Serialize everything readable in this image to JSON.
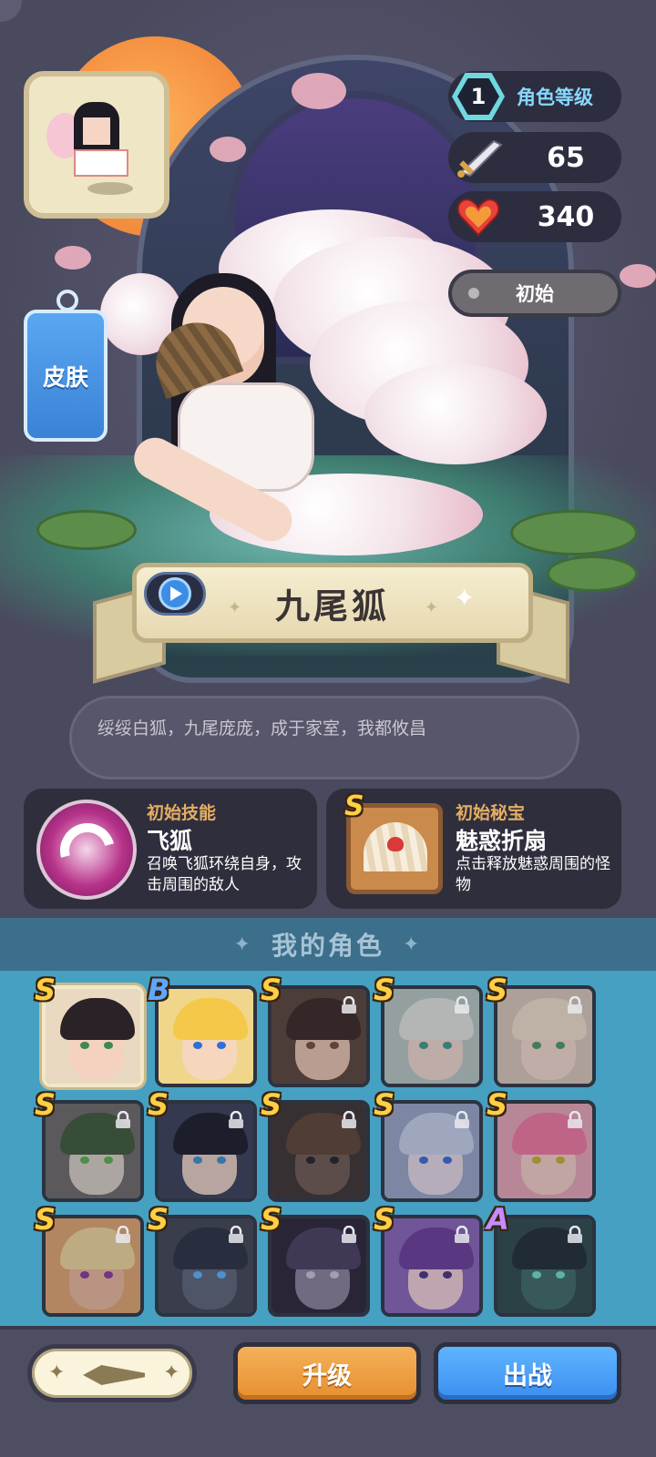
{
  "hero": {
    "name": "九尾狐",
    "quote": "绥绥白狐，九尾庞庞，成于家室，我都攸昌"
  },
  "stats": {
    "level": "1",
    "level_label": "角色等级",
    "attack": "65",
    "hp": "340",
    "status": "初始"
  },
  "skin_tab": {
    "label": "皮肤"
  },
  "skill": {
    "kind": "初始技能",
    "name": "飞狐",
    "desc": "召唤飞狐环绕自身，攻击周围的敌人"
  },
  "relic": {
    "kind": "初始秘宝",
    "grade": "S",
    "name": "魅惑折扇",
    "desc": "点击释放魅惑周围的怪物"
  },
  "roster": {
    "title": "我的角色",
    "characters": [
      {
        "grade": "S",
        "locked": false,
        "selected": true,
        "bg": "#e9d9c0",
        "hair": "#2a2226",
        "skin": "#f4d2bf",
        "eye": "#3c8a4c"
      },
      {
        "grade": "B",
        "locked": false,
        "selected": false,
        "bg": "#f0d68a",
        "hair": "#f5c84a",
        "skin": "#f6d6bd",
        "eye": "#2f6fd6"
      },
      {
        "grade": "S",
        "locked": true,
        "selected": false,
        "bg": "#5a4438",
        "hair": "#3a2622",
        "skin": "#eac4ad",
        "eye": "#7a4a36"
      },
      {
        "grade": "S",
        "locked": true,
        "selected": false,
        "bg": "#b8c8c2",
        "hair": "#e2e6dc",
        "skin": "#efd9cc",
        "eye": "#3f9a8c"
      },
      {
        "grade": "S",
        "locked": true,
        "selected": false,
        "bg": "#d8c9b8",
        "hair": "#efe0c8",
        "skin": "#f3dacb",
        "eye": "#4e9a62"
      },
      {
        "grade": "S",
        "locked": true,
        "selected": false,
        "bg": "#6c6a66",
        "hair": "#3e5a36",
        "skin": "#d8d0c4",
        "eye": "#5ab04c"
      },
      {
        "grade": "S",
        "locked": true,
        "selected": false,
        "bg": "#3a3f56",
        "hair": "#191b26",
        "skin": "#e8cfc0",
        "eye": "#3a8fd0"
      },
      {
        "grade": "S",
        "locked": true,
        "selected": false,
        "bg": "#3d3330",
        "hair": "#5c4434",
        "skin": "#6e5a50",
        "eye": "#222222"
      },
      {
        "grade": "S",
        "locked": true,
        "selected": false,
        "bg": "#9aa6c6",
        "hair": "#c6d2ea",
        "skin": "#e5dbe4",
        "eye": "#3d6ad6"
      },
      {
        "grade": "S",
        "locked": true,
        "selected": false,
        "bg": "#e7a7b6",
        "hair": "#f07aa0",
        "skin": "#f5cfc6",
        "eye": "#c9b12f"
      },
      {
        "grade": "S",
        "locked": true,
        "selected": false,
        "bg": "#e1a66e",
        "hair": "#f1d79a",
        "skin": "#eab99a",
        "eye": "#8a3a9a"
      },
      {
        "grade": "S",
        "locked": true,
        "selected": false,
        "bg": "#3f4552",
        "hair": "#2a3040",
        "skin": "#5a6474",
        "eye": "#5ab6ff"
      },
      {
        "grade": "S",
        "locked": true,
        "selected": false,
        "bg": "#2a2436",
        "hair": "#4a3e5e",
        "skin": "#8a8098",
        "eye": "#c9c9d6"
      },
      {
        "grade": "S",
        "locked": true,
        "selected": false,
        "bg": "#8a64b8",
        "hair": "#6a3e98",
        "skin": "#f1cfd6",
        "eye": "#4a3080"
      },
      {
        "grade": "A",
        "locked": true,
        "selected": false,
        "bg": "#2c4a48",
        "hair": "#1e2c34",
        "skin": "#3e6a64",
        "eye": "#6fe0c8"
      }
    ]
  },
  "buttons": {
    "upgrade": "升级",
    "battle": "出战"
  },
  "colors": {
    "accent_gold": "#e5ad63",
    "upgrade": "#f0a347",
    "battle": "#4da2f8",
    "roster_bg": "#46a0c2"
  },
  "icons": [
    "play-icon",
    "sword-icon",
    "heart-icon",
    "lock-icon",
    "level-hex-icon",
    "emblem-icon"
  ]
}
